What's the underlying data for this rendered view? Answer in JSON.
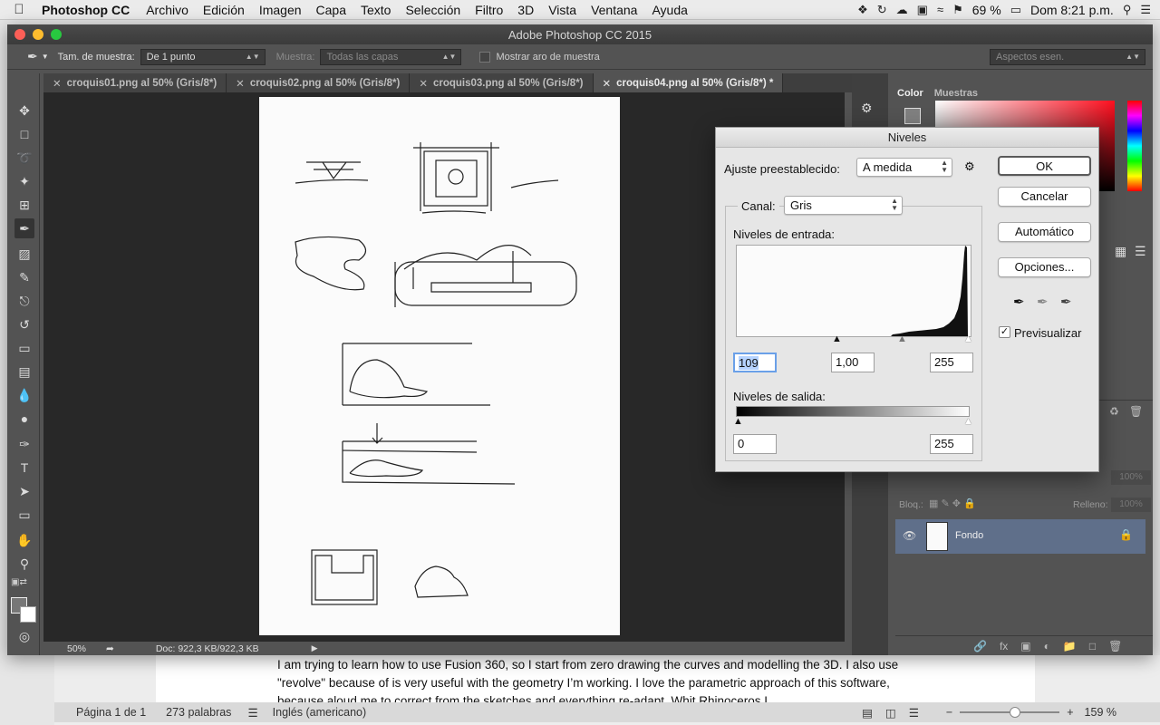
{
  "menubar": {
    "app": "Photoshop CC",
    "items": [
      "Archivo",
      "Edición",
      "Imagen",
      "Capa",
      "Texto",
      "Selección",
      "Filtro",
      "3D",
      "Vista",
      "Ventana",
      "Ayuda"
    ],
    "battery": "69 %",
    "clock": "Dom 8:21 p.m."
  },
  "window": {
    "title": "Adobe Photoshop CC 2015"
  },
  "options_bar": {
    "sample_size_label": "Tam. de muestra:",
    "sample_size_value": "De 1 punto",
    "sample_label": "Muestra:",
    "sample_value": "Todas las capas",
    "show_ring_label": "Mostrar aro de muestra",
    "workspace": "Aspectos esen."
  },
  "tabs": [
    {
      "label": "croquis01.png al 50% (Gris/8*)"
    },
    {
      "label": "croquis02.png al 50% (Gris/8*)"
    },
    {
      "label": "croquis03.png al 50% (Gris/8*)"
    },
    {
      "label": "croquis04.png al 50% (Gris/8*) *"
    }
  ],
  "status": {
    "zoom": "50%",
    "doc": "Doc: 922,3 KB/922,3 KB"
  },
  "panels": {
    "color_tab": "Color",
    "swatches_tab": "Muestras",
    "lock_label": "Bloq.:",
    "fill_label": "Relleno:",
    "opacity_value": "100%",
    "fill_value": "100%",
    "layer_name": "Fondo"
  },
  "niveles": {
    "title": "Niveles",
    "preset_label": "Ajuste preestablecido:",
    "preset_value": "A medida",
    "channel_label": "Canal:",
    "channel_value": "Gris",
    "input_label": "Niveles de entrada:",
    "input_black": "109",
    "input_gamma": "1,00",
    "input_white": "255",
    "output_label": "Niveles de salida:",
    "output_black": "0",
    "output_white": "255",
    "ok": "OK",
    "cancel": "Cancelar",
    "auto": "Automático",
    "options": "Opciones...",
    "preview": "Previsualizar"
  },
  "word": {
    "text": "I am trying to learn how to use Fusion 360, so I start from zero drawing the curves and modelling the 3D. I also use \"revolve\" because of is very useful with the geometry I’m working. I love the parametric approach of this software, because aloud me to correct from the sketches and everything re-adapt. Whit Rhinoceros I",
    "page": "Página 1 de 1",
    "words": "273 palabras",
    "language": "Inglés (americano)",
    "zoom": "159 %"
  }
}
